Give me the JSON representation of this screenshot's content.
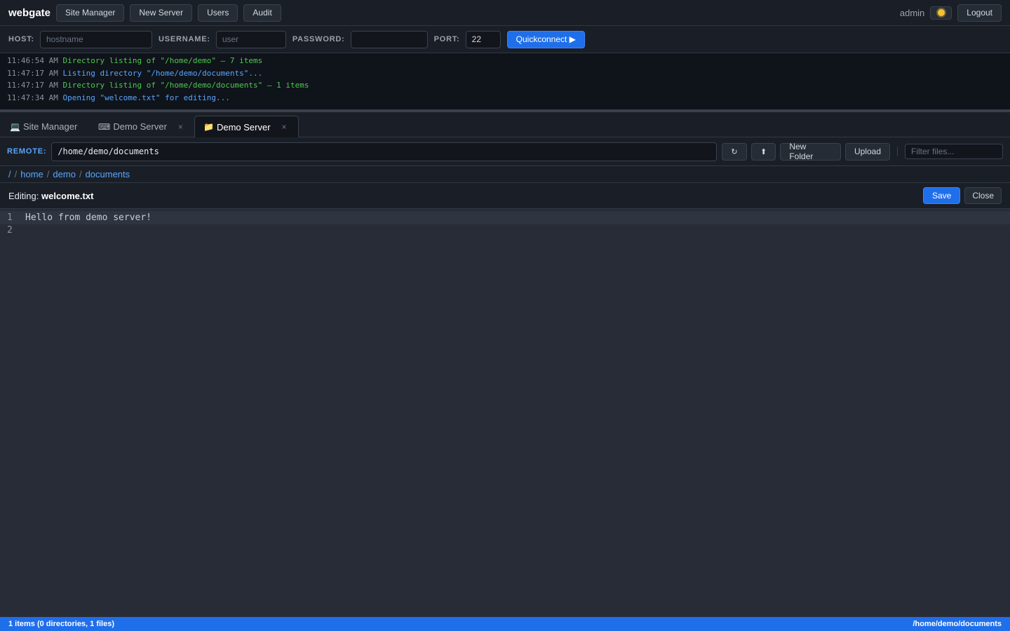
{
  "topbar": {
    "brand": "webgate",
    "nav": [
      "Site Manager",
      "New Server",
      "Users",
      "Audit"
    ],
    "user": "admin",
    "theme_icon": "sun-icon",
    "logout": "Logout"
  },
  "quickconnect": {
    "host_label": "HOST:",
    "host_placeholder": "hostname",
    "username_label": "USERNAME:",
    "username_placeholder": "user",
    "password_label": "PASSWORD:",
    "port_label": "PORT:",
    "port_value": "22",
    "button": "Quickconnect ▶"
  },
  "log": [
    {
      "time": "11:46:54 AM",
      "msg": "Directory listing of \"/home/demo\" — 7 items",
      "kind": "success"
    },
    {
      "time": "11:47:17 AM",
      "msg": "Listing directory \"/home/demo/documents\"...",
      "kind": "info"
    },
    {
      "time": "11:47:17 AM",
      "msg": "Directory listing of \"/home/demo/documents\" — 1 items",
      "kind": "success"
    },
    {
      "time": "11:47:34 AM",
      "msg": "Opening \"welcome.txt\" for editing...",
      "kind": "info"
    }
  ],
  "tabs": [
    {
      "icon": "💻",
      "icon_name": "laptop-icon",
      "label": "Site Manager",
      "closable": false
    },
    {
      "icon": "⌨",
      "icon_name": "keyboard-icon",
      "label": "Demo Server",
      "closable": true
    },
    {
      "icon": "📁",
      "icon_name": "folder-icon",
      "label": "Demo Server",
      "closable": true,
      "active": true
    }
  ],
  "tab_close": "×",
  "remote": {
    "label": "REMOTE:",
    "path": "/home/demo/documents",
    "refresh_icon": "↻",
    "up_icon": "⬆",
    "new_folder": "New Folder",
    "upload": "Upload",
    "filter_placeholder": "Filter files..."
  },
  "breadcrumb": [
    "/",
    "home",
    "demo",
    "documents"
  ],
  "breadcrumb_sep": "/",
  "editor": {
    "prefix": "Editing: ",
    "filename": "welcome.txt",
    "save": "Save",
    "close": "Close",
    "lines": [
      "Hello from demo server!",
      ""
    ]
  },
  "status": {
    "summary": "1 items (0 directories, 1 files)",
    "path": "/home/demo/documents"
  },
  "colors": {
    "accent": "#1f6feb",
    "link": "#58a6ff",
    "log_success": "#4ec94e"
  }
}
